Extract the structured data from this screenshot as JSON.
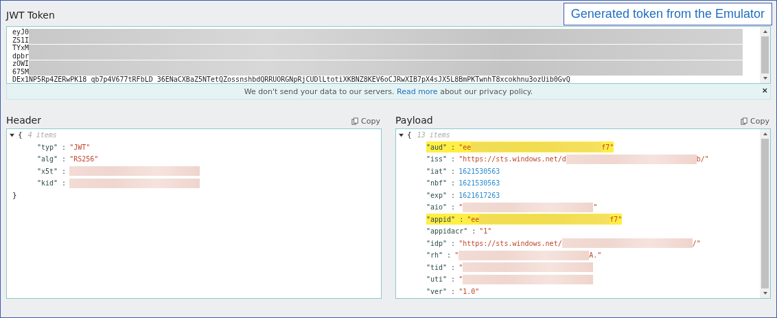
{
  "token": {
    "title": "JWT Token",
    "lines": [
      {
        "text": "eyJ0",
        "redacted": true
      },
      {
        "text": "ZS1I",
        "redacted": true
      },
      {
        "text": "TYxM",
        "redacted": true
      },
      {
        "text": "dpbr",
        "redacted": true
      },
      {
        "text": "zOWI",
        "redacted": true
      },
      {
        "text": "675M",
        "redacted": true
      },
      {
        "text": "DEx1NP5Rp4ZERwPK18_qb7p4V677tRFbLD_36ENaCXBaZ5NTetQZossnshbdQRRUORGNpRjCUDlLtotiXKBNZ8KEV6oCJRwXIB7pX4sJX5L8BmPKTwnhT8xcokhnu3ozUib0GvQ",
        "redacted": false
      }
    ]
  },
  "privacy": {
    "before": "We don't send your data to our servers.",
    "link": "Read more",
    "after": "about our privacy policy.",
    "close": "×"
  },
  "callout": "Generated token from the Emulator",
  "panels": [
    {
      "title": "Header",
      "copy": "Copy",
      "open_brace": "{",
      "count": "4 items",
      "close_brace": "}",
      "expanded": true,
      "scrollbar": false,
      "entries": [
        {
          "key": "\"typ\" :",
          "kind": "string",
          "start": "\"JWT\"",
          "redacted": false,
          "highlighted": false
        },
        {
          "key": "\"alg\" :",
          "kind": "string",
          "start": "\"RS256\"",
          "redacted": false,
          "highlighted": false
        },
        {
          "key": "\"x5t\" :",
          "kind": "string",
          "redacted": true,
          "highlighted": false
        },
        {
          "key": "\"kid\" :",
          "kind": "string",
          "redacted": true,
          "highlighted": false
        }
      ]
    },
    {
      "title": "Payload",
      "copy": "Copy",
      "open_brace": "{",
      "count": "13 items",
      "expanded": true,
      "scrollbar": true,
      "entries": [
        {
          "key": "\"aud\" :",
          "kind": "string",
          "start": "\"ee",
          "redacted": true,
          "end": "f7\"",
          "highlighted": true
        },
        {
          "key": "\"iss\" :",
          "kind": "string",
          "start": "\"https://sts.windows.net/d",
          "redacted": true,
          "end": "b/\"",
          "highlighted": false
        },
        {
          "key": "\"iat\" :",
          "kind": "number",
          "start": "1621530563",
          "redacted": false,
          "highlighted": false
        },
        {
          "key": "\"nbf\" :",
          "kind": "number",
          "start": "1621530563",
          "redacted": false,
          "highlighted": false
        },
        {
          "key": "\"exp\" :",
          "kind": "number",
          "start": "1621617263",
          "redacted": false,
          "highlighted": false
        },
        {
          "key": "\"aio\" :",
          "kind": "string",
          "start": "\"",
          "redacted": true,
          "end": "\"",
          "highlighted": false
        },
        {
          "key": "\"appid\" :",
          "kind": "string",
          "start": "\"ee",
          "redacted": true,
          "end": "f7\"",
          "highlighted": true
        },
        {
          "key": "\"appidacr\" :",
          "kind": "string",
          "start": "\"1\"",
          "redacted": false,
          "highlighted": false
        },
        {
          "key": "\"idp\" :",
          "kind": "string",
          "start": "\"https://sts.windows.net/",
          "redacted": true,
          "end": "/\"",
          "highlighted": false
        },
        {
          "key": "\"rh\" :",
          "kind": "string",
          "start": "\"",
          "redacted": true,
          "end": "A.\"",
          "highlighted": false
        },
        {
          "key": "\"tid\" :",
          "kind": "string",
          "start": "\"",
          "redacted": true,
          "highlighted": false
        },
        {
          "key": "\"uti\" :",
          "kind": "string",
          "start": "\"",
          "redacted": true,
          "highlighted": false
        },
        {
          "key": "\"ver\" :",
          "kind": "string",
          "start": "\"1.0\"",
          "redacted": false,
          "highlighted": false
        }
      ]
    }
  ]
}
